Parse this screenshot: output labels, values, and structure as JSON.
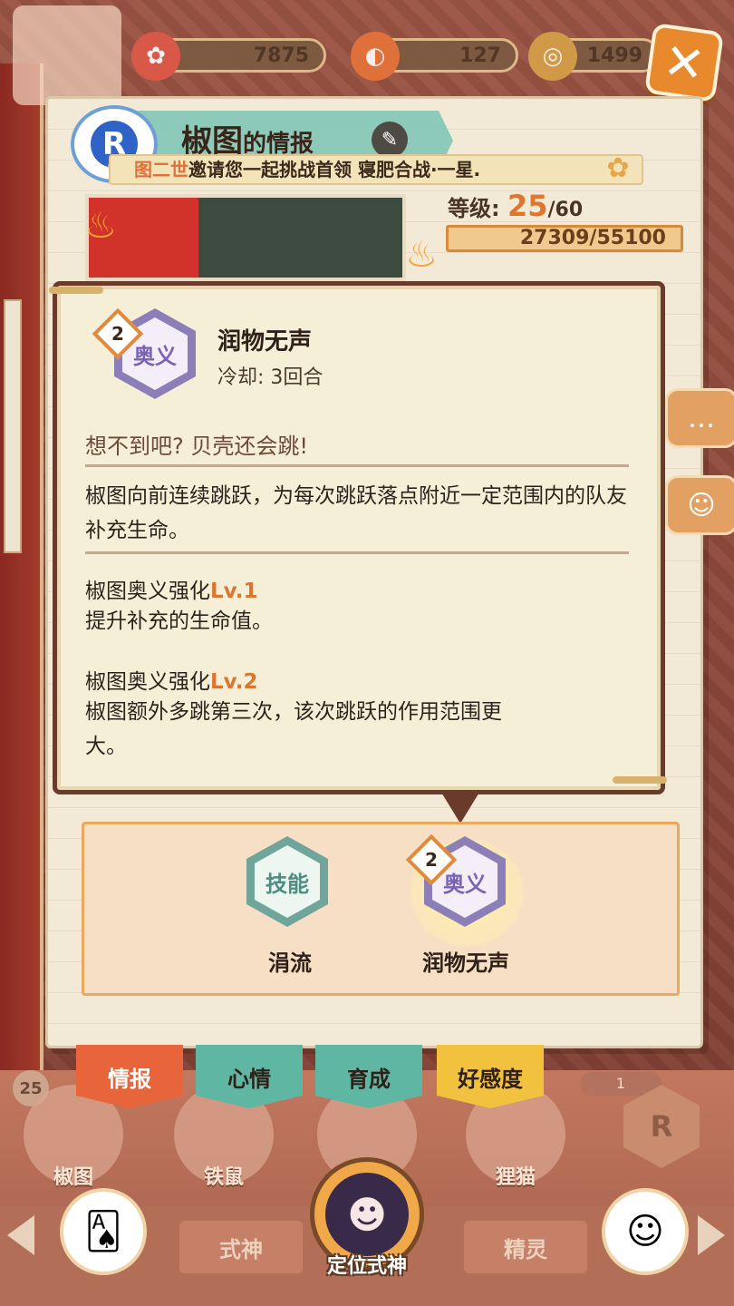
{
  "currency": {
    "first_value": "7875",
    "second_value": "127",
    "third_value": "1499"
  },
  "header": {
    "title_main": "椒图",
    "title_suffix": "的情报",
    "badge_letter": "R",
    "invite_highlight": "图二世",
    "invite_text": "邀请您一起挑战首领 寝肥合战·一星."
  },
  "stats": {
    "level_label": "等级:",
    "level_value": "25",
    "level_max": "/60",
    "exp_text": "27309/55100"
  },
  "skill_popup": {
    "rank": "2",
    "icon_text": "奥义",
    "name": "润物无声",
    "cooldown": "冷却:  3回合",
    "quote": "想不到吧? 贝壳还会跳!",
    "description": "椒图向前连续跳跃，为每次跳跃落点附近一定范围内的队友补充生命。",
    "upgrades": [
      {
        "title": "椒图奥义强化",
        "level": "Lv.1",
        "desc": "提升补充的生命值。"
      },
      {
        "title": "椒图奥义强化",
        "level": "Lv.2",
        "desc": "椒图额外多跳第三次，该次跳跃的作用范围更大。"
      }
    ]
  },
  "skill_slots": [
    {
      "icon_text": "技能",
      "label": "涓流"
    },
    {
      "icon_text": "奥义",
      "label": "润物无声",
      "rank": "2"
    }
  ],
  "tabs": [
    {
      "label": "情报",
      "color": "#e8643a"
    },
    {
      "label": "心情",
      "color": "#5fb6a2"
    },
    {
      "label": "育成",
      "color": "#5fb6a2"
    },
    {
      "label": "好感度",
      "color": "#f2c23e"
    }
  ],
  "roster": {
    "level_badge": "25",
    "count_chip": "1",
    "r_badge": "R",
    "characters": [
      "椒图",
      "铁鼠",
      "",
      "狸猫"
    ]
  },
  "bottom": {
    "tab_left": "式神",
    "tab_right": "精灵",
    "locate_label": "定位式神"
  }
}
